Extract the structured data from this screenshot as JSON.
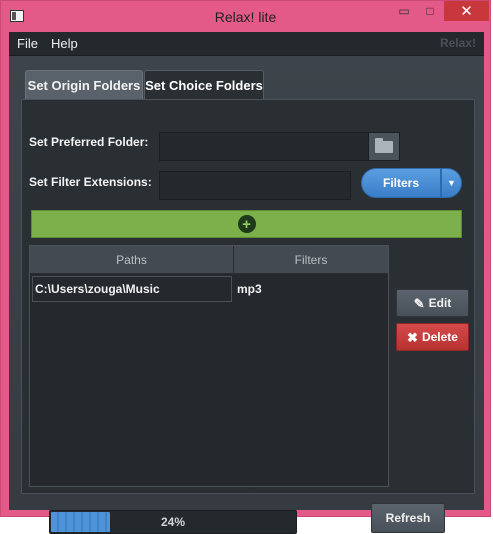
{
  "window": {
    "title": "Relax! lite",
    "minimize_glyph": "▭",
    "maximize_glyph": "□",
    "close_glyph": "✕"
  },
  "menubar": {
    "items": [
      {
        "label": "File"
      },
      {
        "label": "Help"
      }
    ],
    "brand": "Relax!"
  },
  "tabs": [
    {
      "label": "Set Origin Folders",
      "active": false
    },
    {
      "label": "Set Choice Folders",
      "active": true
    }
  ],
  "form": {
    "preferred_folder_label": "Set Preferred Folder:",
    "preferred_folder_value": "",
    "filter_extensions_label": "Set Filter Extensions:",
    "filter_extensions_value": "",
    "filters_button_label": "Filters",
    "filters_arrow_glyph": "▼",
    "add_glyph": "+"
  },
  "table": {
    "columns": [
      "Paths",
      "Filters"
    ],
    "rows": [
      {
        "path": "C:\\Users\\zouga\\Music",
        "filter": "mp3"
      }
    ]
  },
  "actions": {
    "edit_label": "Edit",
    "edit_icon_glyph": "✎",
    "delete_label": "Delete",
    "delete_icon_glyph": "✖",
    "refresh_label": "Refresh"
  },
  "progress": {
    "value": 0.24,
    "text": "24%"
  },
  "colors": {
    "window_frame": "#e35a88",
    "accent_blue": "#4a8fd6",
    "add_green": "#7bb04a",
    "delete_red": "#c93d3d"
  }
}
